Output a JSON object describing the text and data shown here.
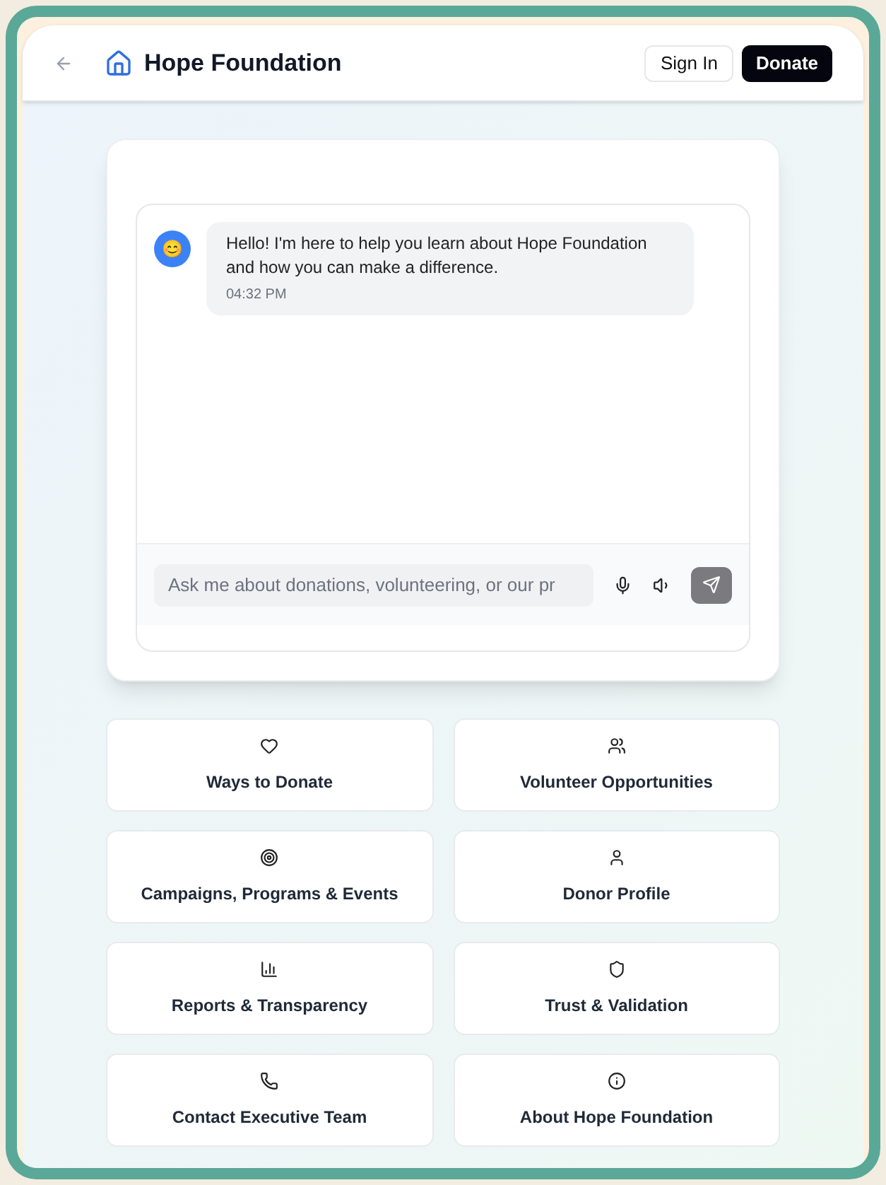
{
  "header": {
    "title": "Hope Foundation",
    "sign_in": "Sign In",
    "donate": "Donate"
  },
  "chat": {
    "messages": [
      {
        "avatar": "😊",
        "text": "Hello! I'm here to help you learn about Hope Foundation and how you can make a difference.",
        "time": "04:32 PM"
      }
    ],
    "input": {
      "placeholder": "Ask me about donations, volunteering, or our pr"
    }
  },
  "tiles": [
    {
      "label": "Ways to Donate"
    },
    {
      "label": "Volunteer Opportunities"
    },
    {
      "label": "Campaigns, Programs & Events"
    },
    {
      "label": "Donor Profile"
    },
    {
      "label": "Reports & Transparency"
    },
    {
      "label": "Trust & Validation"
    },
    {
      "label": "Contact Executive Team"
    },
    {
      "label": "About Hope Foundation"
    }
  ]
}
